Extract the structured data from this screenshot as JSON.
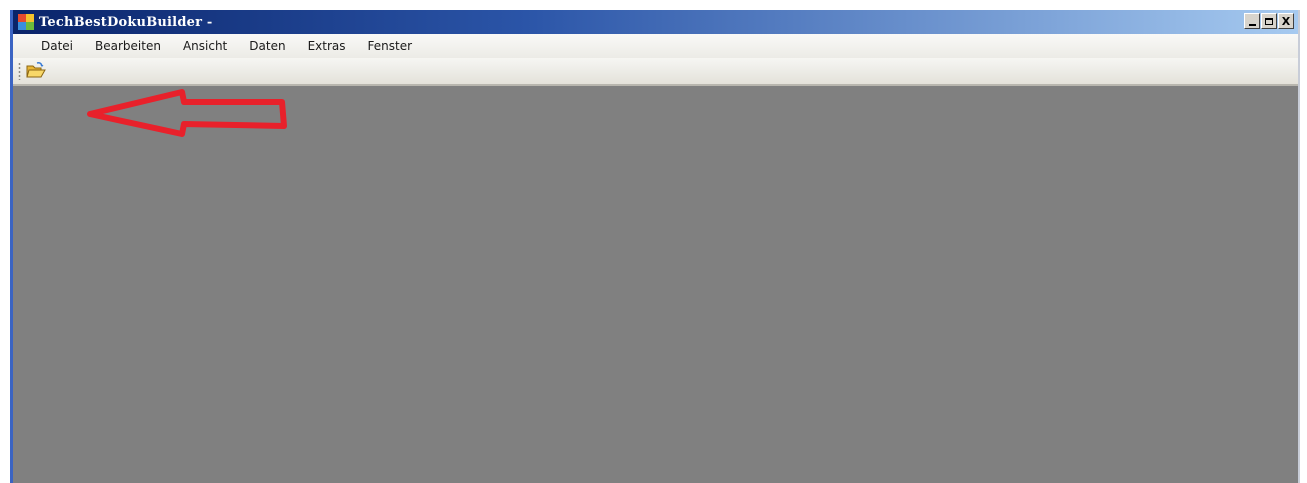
{
  "window": {
    "title": "TechBestDokuBuilder -",
    "controls": {
      "minimize_icon": "minimize-icon",
      "maximize_icon": "maximize-icon",
      "close_label": "X"
    }
  },
  "menubar": {
    "items": [
      {
        "label": "Datei"
      },
      {
        "label": "Bearbeiten"
      },
      {
        "label": "Ansicht"
      },
      {
        "label": "Daten"
      },
      {
        "label": "Extras"
      },
      {
        "label": "Fenster"
      }
    ]
  },
  "toolbar": {
    "buttons": [
      {
        "icon": "open-folder-icon"
      }
    ]
  },
  "workspace": {
    "background": "#808080"
  },
  "annotation": {
    "color": "#e8212b",
    "icon": "arrow-left-icon"
  },
  "colors": {
    "titlebar_start": "#0a246a",
    "titlebar_end": "#a6caf0",
    "menubar": "#f2f1ed"
  }
}
